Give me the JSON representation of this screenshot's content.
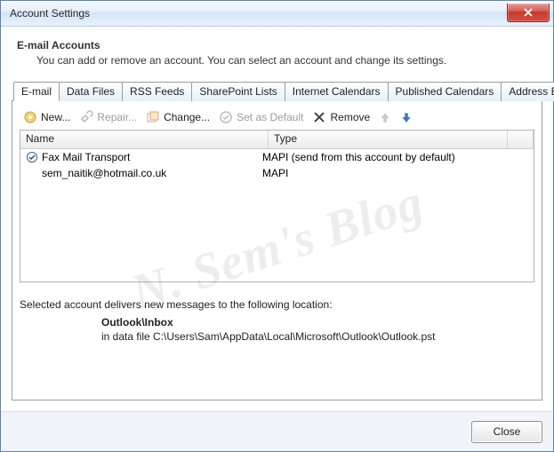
{
  "window": {
    "title": "Account Settings"
  },
  "header": {
    "title": "E-mail Accounts",
    "desc": "You can add or remove an account. You can select an account and change its settings."
  },
  "tabs": [
    {
      "label": "E-mail"
    },
    {
      "label": "Data Files"
    },
    {
      "label": "RSS Feeds"
    },
    {
      "label": "SharePoint Lists"
    },
    {
      "label": "Internet Calendars"
    },
    {
      "label": "Published Calendars"
    },
    {
      "label": "Address Books"
    }
  ],
  "toolbar": {
    "new_label": "New...",
    "repair_label": "Repair...",
    "change_label": "Change...",
    "default_label": "Set as Default",
    "remove_label": "Remove"
  },
  "list": {
    "columns": {
      "name": "Name",
      "type": "Type"
    },
    "rows": [
      {
        "name": "Fax Mail Transport",
        "type": "MAPI (send from this account by default)",
        "default": true
      },
      {
        "name": "sem_naitik@hotmail.co.uk",
        "type": "MAPI",
        "default": false
      }
    ]
  },
  "info": {
    "intro": "Selected account delivers new messages to the following location:",
    "location_label": "Outlook\\Inbox",
    "path_prefix": "in data file ",
    "path": "C:\\Users\\Sam\\AppData\\Local\\Microsoft\\Outlook\\Outlook.pst"
  },
  "footer": {
    "close_label": "Close"
  },
  "watermark": "N. Sem's Blog"
}
